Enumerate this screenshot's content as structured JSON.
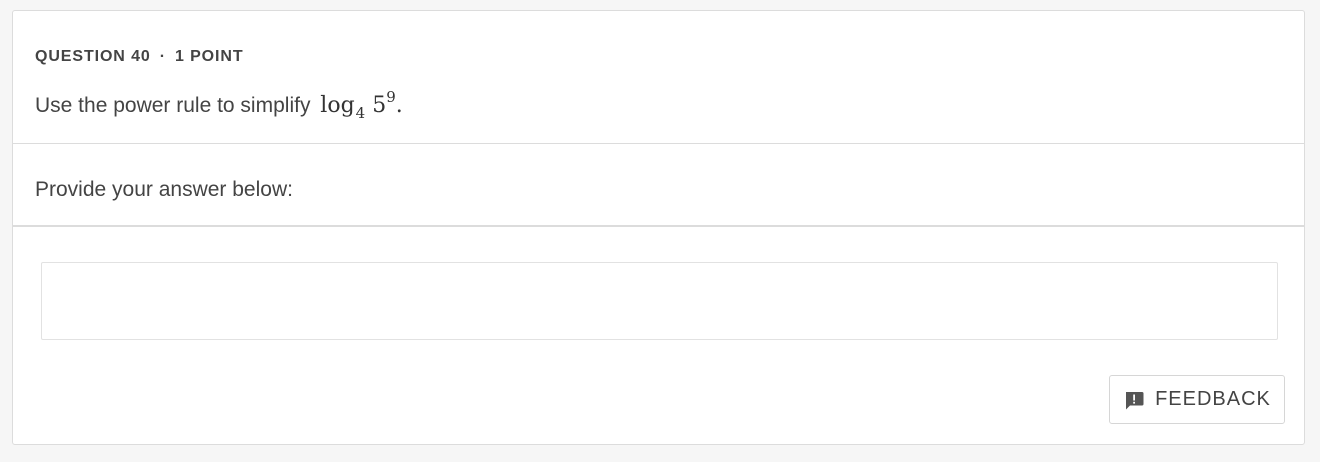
{
  "question": {
    "number_label": "QUESTION 40",
    "separator": "·",
    "points_label": "1 POINT",
    "prompt_text": "Use the power rule to simplify",
    "math": {
      "func": "log",
      "base": "4",
      "argument": "5",
      "exponent": "9",
      "trailing": "."
    }
  },
  "answer": {
    "label": "Provide your answer below:",
    "value": ""
  },
  "feedback": {
    "label": "FEEDBACK",
    "icon": "feedback-exclamation-icon"
  },
  "colors": {
    "text": "#444444",
    "border": "#dcdcdc",
    "background": "#f6f6f6",
    "card": "#ffffff"
  }
}
